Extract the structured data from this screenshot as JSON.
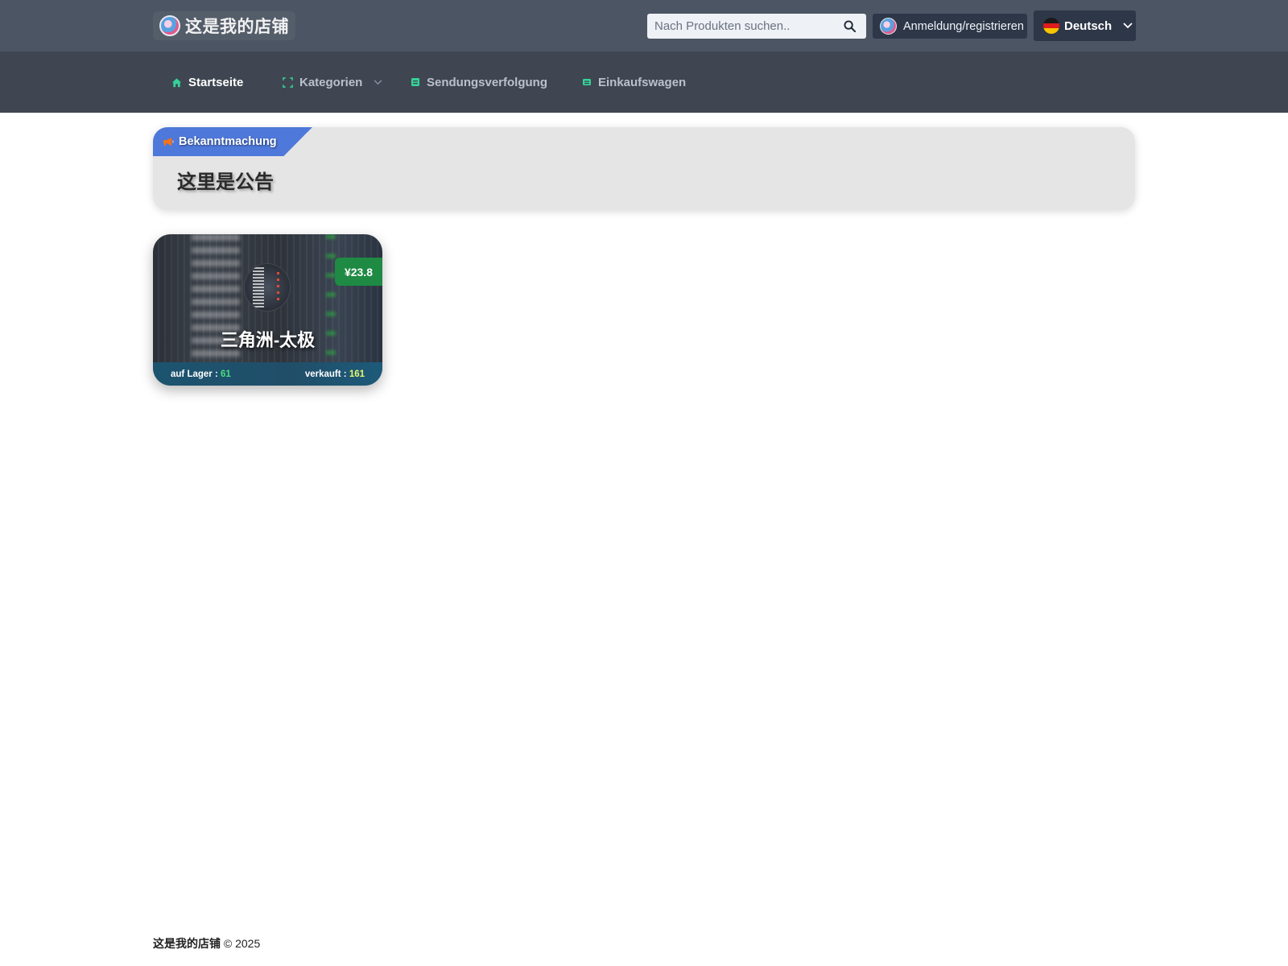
{
  "header": {
    "brand_name": "这是我的店铺",
    "search_placeholder": "Nach Produkten suchen..",
    "login_label": "Anmeldung/registrieren",
    "language_label": "Deutsch"
  },
  "nav": {
    "items": [
      {
        "label": "Startseite",
        "icon": "home-icon",
        "active": true
      },
      {
        "label": "Kategorien",
        "icon": "grid-icon",
        "dropdown": true
      },
      {
        "label": "Sendungsverfolgung",
        "icon": "list-icon"
      },
      {
        "label": "Einkaufswagen",
        "icon": "cart-icon"
      }
    ]
  },
  "announcement": {
    "tag_label": "Bekanntmachung",
    "text": "这里是公告"
  },
  "products": [
    {
      "name": "三角洲-太极",
      "price": "¥23.8",
      "stock_label": "auf Lager :",
      "stock_value": "61",
      "sold_label": "verkauft :",
      "sold_value": "161"
    }
  ],
  "footer": {
    "brand": "这是我的店铺",
    "copyright": "© 2025"
  },
  "colors": {
    "header_bg": "#4b5563",
    "nav_bg": "#3f4651",
    "accent_green": "#4ade80",
    "announce_tag": "#4e78d9",
    "price_badge": "#1e8a43"
  }
}
